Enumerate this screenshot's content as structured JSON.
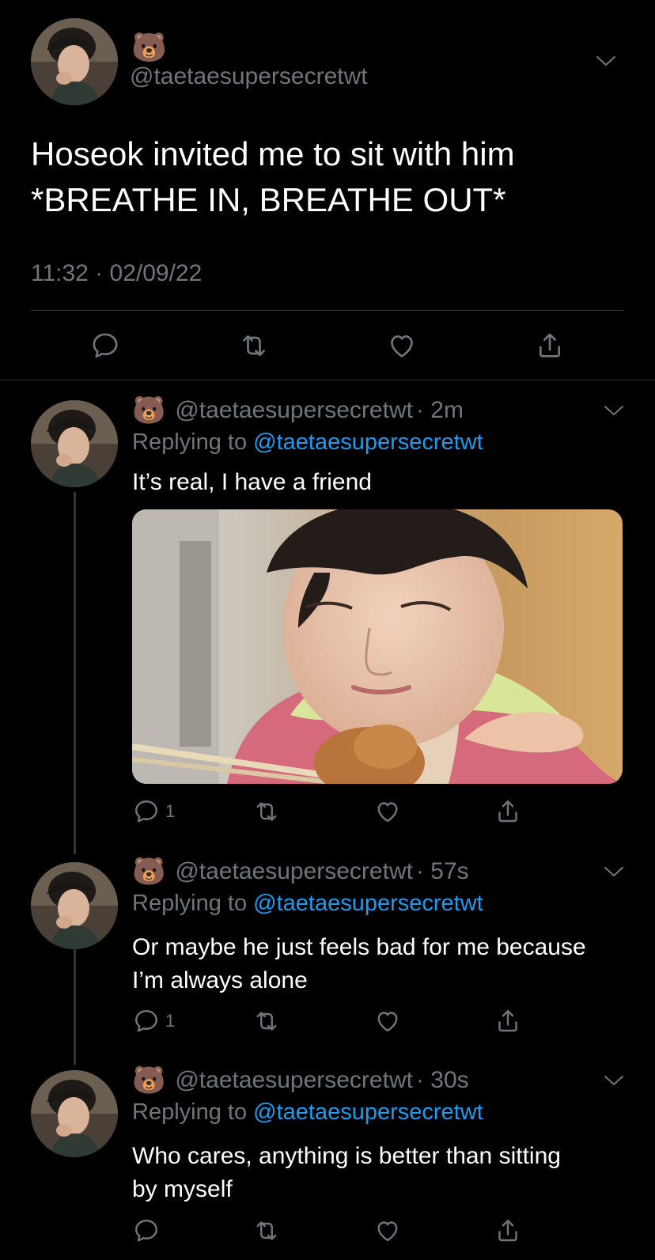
{
  "main_tweet": {
    "display_emoji": "🐻",
    "handle": "@taetaesupersecretwt",
    "text_line1": "Hoseok invited me to sit with him",
    "text_line2": "*BREATHE IN, BREATHE OUT*",
    "timestamp": "11:32 · 02/09/22"
  },
  "replies": [
    {
      "display_emoji": "🐻",
      "handle": "@taetaesupersecretwt",
      "time": "· 2m",
      "replying_prefix": "Replying to",
      "replying_handle": "@taetaesupersecretwt",
      "text": "It’s real, I have a friend",
      "reply_count": "1"
    },
    {
      "display_emoji": "🐻",
      "handle": "@taetaesupersecretwt",
      "time": "· 57s",
      "replying_prefix": "Replying to",
      "replying_handle": "@taetaesupersecretwt",
      "text_line1": "Or maybe he just feels bad for me because",
      "text_line2": "I’m always alone",
      "reply_count": "1"
    },
    {
      "display_emoji": "🐻",
      "handle": "@taetaesupersecretwt",
      "time": "· 30s",
      "replying_prefix": "Replying to",
      "replying_handle": "@taetaesupersecretwt",
      "text_line1": "Who cares, anything is better than sitting",
      "text_line2": "by myself",
      "reply_count": ""
    }
  ],
  "icons": {
    "more": "chevron-down-icon",
    "reply": "speech-bubble-icon",
    "retweet": "retweet-icon",
    "like": "heart-icon",
    "share": "share-icon"
  },
  "colors": {
    "background": "#000000",
    "text": "#ffffff",
    "muted": "#6e767d",
    "link": "#1d9bf0",
    "divider": "#2f3336"
  }
}
